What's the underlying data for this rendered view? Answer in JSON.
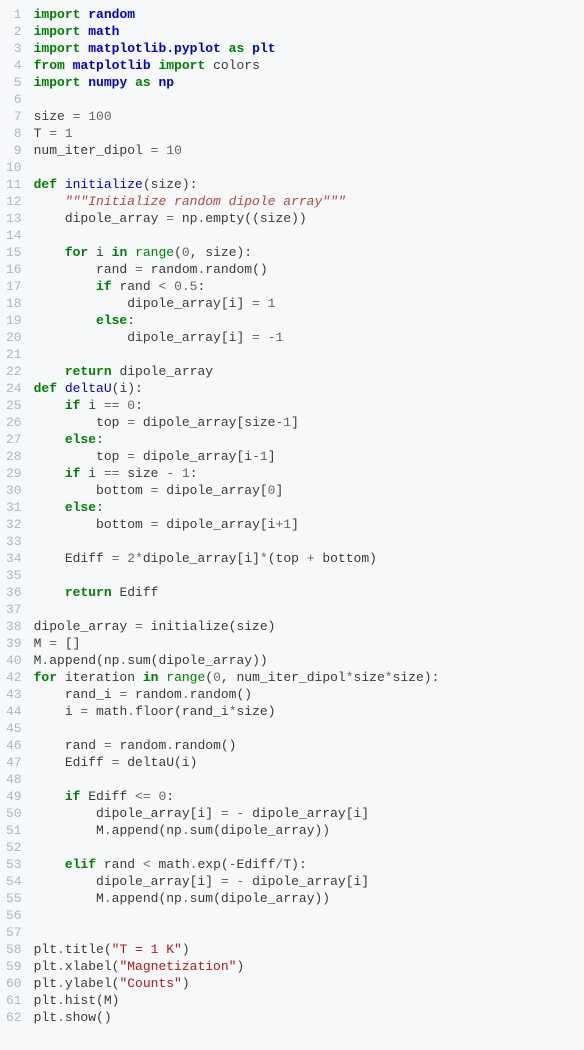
{
  "lines": [
    {
      "n": "1",
      "h": "<span class=\"kw\">import</span> <span class=\"nn\">random</span>"
    },
    {
      "n": "2",
      "h": "<span class=\"kw\">import</span> <span class=\"nn\">math</span>"
    },
    {
      "n": "3",
      "h": "<span class=\"kw\">import</span> <span class=\"nn\">matplotlib.pyplot</span> <span class=\"kw\">as</span> <span class=\"nn\">plt</span>"
    },
    {
      "n": "4",
      "h": "<span class=\"kw\">from</span> <span class=\"nn\">matplotlib</span> <span class=\"kw\">import</span> colors"
    },
    {
      "n": "5",
      "h": "<span class=\"kw\">import</span> <span class=\"nn\">numpy</span> <span class=\"kw\">as</span> <span class=\"nn\">np</span>"
    },
    {
      "n": "6",
      "h": ""
    },
    {
      "n": "7",
      "h": "size <span class=\"op\">=</span> <span class=\"num\">100</span>"
    },
    {
      "n": "8",
      "h": "T <span class=\"op\">=</span> <span class=\"num\">1</span>"
    },
    {
      "n": "9",
      "h": "num_iter_dipol <span class=\"op\">=</span> <span class=\"num\">10</span>"
    },
    {
      "n": "10",
      "h": ""
    },
    {
      "n": "11",
      "h": "<span class=\"kw\">def</span> <span class=\"fn\">initialize</span>(size):"
    },
    {
      "n": "12",
      "h": "    <span class=\"ds\">\"\"\"Initialize random dipole array\"\"\"</span>"
    },
    {
      "n": "13",
      "h": "    dipole_array <span class=\"op\">=</span> np<span class=\"op\">.</span>empty((size))"
    },
    {
      "n": "14",
      "h": ""
    },
    {
      "n": "15",
      "h": "    <span class=\"kw\">for</span> i <span class=\"kw\">in</span> <span class=\"bi\">range</span>(<span class=\"num\">0</span>, size):"
    },
    {
      "n": "16",
      "h": "        rand <span class=\"op\">=</span> random<span class=\"op\">.</span>random()"
    },
    {
      "n": "17",
      "h": "        <span class=\"kw\">if</span> rand <span class=\"op\">&lt;</span> <span class=\"num\">0.5</span>:"
    },
    {
      "n": "18",
      "h": "            dipole_array[i] <span class=\"op\">=</span> <span class=\"num\">1</span>"
    },
    {
      "n": "19",
      "h": "        <span class=\"kw\">else</span>:"
    },
    {
      "n": "20",
      "h": "            dipole_array[i] <span class=\"op\">=</span> <span class=\"op\">-</span><span class=\"num\">1</span>"
    },
    {
      "n": "21",
      "h": ""
    },
    {
      "n": "22",
      "h": "    <span class=\"kw\">return</span> dipole_array"
    },
    {
      "n": "24",
      "h": "<span class=\"kw\">def</span> <span class=\"fn\">deltaU</span>(i):"
    },
    {
      "n": "25",
      "h": "    <span class=\"kw\">if</span> i <span class=\"op\">==</span> <span class=\"num\">0</span>:"
    },
    {
      "n": "26",
      "h": "        top <span class=\"op\">=</span> dipole_array[size<span class=\"op\">-</span><span class=\"num\">1</span>]"
    },
    {
      "n": "27",
      "h": "    <span class=\"kw\">else</span>:"
    },
    {
      "n": "28",
      "h": "        top <span class=\"op\">=</span> dipole_array[i<span class=\"op\">-</span><span class=\"num\">1</span>]"
    },
    {
      "n": "29",
      "h": "    <span class=\"kw\">if</span> i <span class=\"op\">==</span> size <span class=\"op\">-</span> <span class=\"num\">1</span>:"
    },
    {
      "n": "30",
      "h": "        bottom <span class=\"op\">=</span> dipole_array[<span class=\"num\">0</span>]"
    },
    {
      "n": "31",
      "h": "    <span class=\"kw\">else</span>:"
    },
    {
      "n": "32",
      "h": "        bottom <span class=\"op\">=</span> dipole_array[i<span class=\"op\">+</span><span class=\"num\">1</span>]"
    },
    {
      "n": "33",
      "h": ""
    },
    {
      "n": "34",
      "h": "    Ediff <span class=\"op\">=</span> <span class=\"num\">2</span><span class=\"op\">*</span>dipole_array[i]<span class=\"op\">*</span>(top <span class=\"op\">+</span> bottom)"
    },
    {
      "n": "35",
      "h": ""
    },
    {
      "n": "36",
      "h": "    <span class=\"kw\">return</span> Ediff"
    },
    {
      "n": "37",
      "h": ""
    },
    {
      "n": "38",
      "h": "dipole_array <span class=\"op\">=</span> initialize(size)"
    },
    {
      "n": "39",
      "h": "M <span class=\"op\">=</span> []"
    },
    {
      "n": "40",
      "h": "M<span class=\"op\">.</span>append(np<span class=\"op\">.</span>sum(dipole_array))"
    },
    {
      "n": "42",
      "h": "<span class=\"kw\">for</span> iteration <span class=\"kw\">in</span> <span class=\"bi\">range</span>(<span class=\"num\">0</span>, num_iter_dipol<span class=\"op\">*</span>size<span class=\"op\">*</span>size):"
    },
    {
      "n": "43",
      "h": "    rand_i <span class=\"op\">=</span> random<span class=\"op\">.</span>random()"
    },
    {
      "n": "44",
      "h": "    i <span class=\"op\">=</span> math<span class=\"op\">.</span>floor(rand_i<span class=\"op\">*</span>size)"
    },
    {
      "n": "45",
      "h": ""
    },
    {
      "n": "46",
      "h": "    rand <span class=\"op\">=</span> random<span class=\"op\">.</span>random()"
    },
    {
      "n": "47",
      "h": "    Ediff <span class=\"op\">=</span> deltaU(i)"
    },
    {
      "n": "48",
      "h": ""
    },
    {
      "n": "49",
      "h": "    <span class=\"kw\">if</span> Ediff <span class=\"op\">&lt;=</span> <span class=\"num\">0</span>:"
    },
    {
      "n": "50",
      "h": "        dipole_array[i] <span class=\"op\">=</span> <span class=\"op\">-</span> dipole_array[i]"
    },
    {
      "n": "51",
      "h": "        M<span class=\"op\">.</span>append(np<span class=\"op\">.</span>sum(dipole_array))"
    },
    {
      "n": "52",
      "h": ""
    },
    {
      "n": "53",
      "h": "    <span class=\"kw\">elif</span> rand <span class=\"op\">&lt;</span> math<span class=\"op\">.</span>exp(<span class=\"op\">-</span>Ediff<span class=\"op\">/</span>T):"
    },
    {
      "n": "54",
      "h": "        dipole_array[i] <span class=\"op\">=</span> <span class=\"op\">-</span> dipole_array[i]"
    },
    {
      "n": "55",
      "h": "        M<span class=\"op\">.</span>append(np<span class=\"op\">.</span>sum(dipole_array))"
    },
    {
      "n": "56",
      "h": ""
    },
    {
      "n": "57",
      "h": ""
    },
    {
      "n": "58",
      "h": "plt<span class=\"op\">.</span>title(<span class=\"st\">\"T = 1 K\"</span>)"
    },
    {
      "n": "59",
      "h": "plt<span class=\"op\">.</span>xlabel(<span class=\"st\">\"Magnetization\"</span>)"
    },
    {
      "n": "60",
      "h": "plt<span class=\"op\">.</span>ylabel(<span class=\"st\">\"Counts\"</span>)"
    },
    {
      "n": "61",
      "h": "plt<span class=\"op\">.</span>hist(M)"
    },
    {
      "n": "62",
      "h": "plt<span class=\"op\">.</span>show()"
    }
  ]
}
